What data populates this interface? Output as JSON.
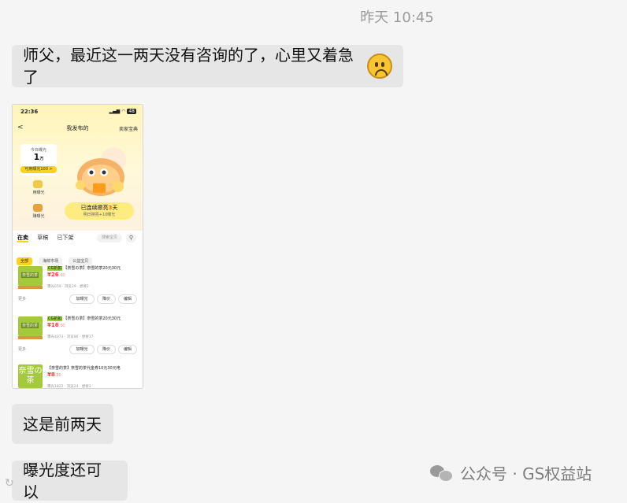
{
  "chat": {
    "timestamp": "昨天 10:45",
    "messages": [
      {
        "text": "师父，最近这一两天没有咨询的了，心里又着急了",
        "emoji": "frowning-face"
      },
      {
        "text": "这是前两天"
      },
      {
        "text": "曝光度还可以"
      }
    ]
  },
  "screenshot": {
    "status_time": "22:36",
    "status_battery": "48",
    "nav": {
      "title": "我发布的",
      "right": "卖家宝典"
    },
    "exposure": {
      "label": "今日曝光",
      "value": "1",
      "unit": "万",
      "available": "可用曝光100 >"
    },
    "side": {
      "item1": "用曝光",
      "item2": "赚曝光"
    },
    "streak": {
      "title_prefix": "已连续擦亮",
      "days": "3",
      "title_suffix": "天",
      "sub": "明日擦亮+10曝光"
    },
    "tabs": [
      "在卖",
      "草稿",
      "已下架"
    ],
    "search_placeholder": "搜索宝贝",
    "filters": [
      "全部",
      "海鲜市场",
      "公益宝贝"
    ],
    "items": [
      {
        "tag": "CG折扣",
        "title": "【奈雪の茶】奈雪的茶20元30元",
        "price": "¥26",
        "cents": ".00",
        "meta": "曝光659 · 浏览29 · 想要2",
        "more": "更多",
        "actions": [
          "加曝光",
          "降价",
          "编辑"
        ]
      },
      {
        "tag": "CG折扣",
        "title": "【奈雪の茶】奈雪的茶20元30元",
        "price": "¥16",
        "cents": ".00",
        "meta": "曝光4073 · 浏览86 · 想要17",
        "more": "更多",
        "actions": [
          "加曝光",
          "降价",
          "编辑"
        ]
      },
      {
        "title": "【奈雪的茶】奈雪的茶代金券10元30元电",
        "price": "¥8",
        "cents": ".80",
        "meta": "曝光1822 · 浏览24 · 想要3",
        "thumb": "奈雪の茶"
      }
    ],
    "thumb_label": "奈雪的茶"
  },
  "watermark": {
    "text": "公众号 · GS权益站"
  }
}
